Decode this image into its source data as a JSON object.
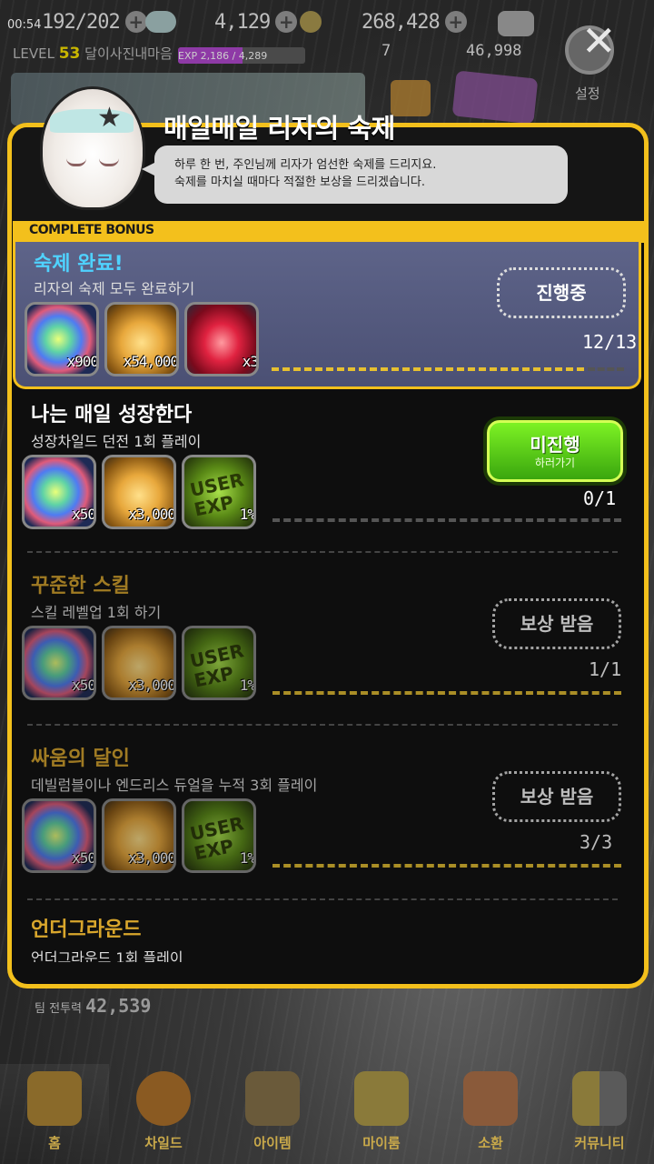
{
  "status": {
    "clock": "00:54",
    "stamina": "192/202",
    "gems": "4,129",
    "gold": "268,428",
    "level_prefix": "LEVEL",
    "level": "53",
    "username": "달이사진내마음",
    "exp": "EXP 2,186 / 4,289",
    "exp_fraction": 0.51,
    "tickets": "7",
    "points": "46,998",
    "settings_label": "설정"
  },
  "dialog": {
    "title": "매일매일 리자의 숙제",
    "message_line1": "하루 한 번, 주인님께 리자가 엄선한 숙제를 드리지요.",
    "message_line2": "숙제를 마치실 때마다 적절한 보상을 드리겠습니다.",
    "bonus_tag": "COMPLETE BONUS"
  },
  "quests": [
    {
      "title": "숙제 완료!",
      "desc": "리자의 숙제 모두 완료하기",
      "rewards": [
        {
          "type": "gem",
          "count": "x900"
        },
        {
          "type": "gold",
          "count": "x54,000"
        },
        {
          "type": "ruby",
          "count": "x3"
        }
      ],
      "button": "진행중",
      "progress": "12/13"
    },
    {
      "title": "나는 매일 성장한다",
      "desc": "성장차일드 던전 1회 플레이",
      "rewards": [
        {
          "type": "gem",
          "count": "x50"
        },
        {
          "type": "gold",
          "count": "x3,000"
        },
        {
          "type": "exp",
          "count": "1%"
        }
      ],
      "button": "미진행",
      "button_sub": "하러가기",
      "progress": "0/1"
    },
    {
      "title": "꾸준한 스킬",
      "desc": "스킬 레벨업 1회 하기",
      "rewards": [
        {
          "type": "gem",
          "count": "x50"
        },
        {
          "type": "gold",
          "count": "x3,000"
        },
        {
          "type": "exp",
          "count": "1%"
        }
      ],
      "button": "보상 받음",
      "progress": "1/1"
    },
    {
      "title": "싸움의 달인",
      "desc": "데빌럼블이나 엔드리스 듀얼을 누적 3회 플레이",
      "rewards": [
        {
          "type": "gem",
          "count": "x50"
        },
        {
          "type": "gold",
          "count": "x3,000"
        },
        {
          "type": "exp",
          "count": "1%"
        }
      ],
      "button": "보상 받음",
      "progress": "3/3"
    },
    {
      "title": "언더그라운드",
      "desc": "언더그라운드 1회 플레이"
    }
  ],
  "exp_icon_text": "USER EXP",
  "team_power_label": "팀 전투력",
  "team_power": "42,539",
  "nav": [
    "홈",
    "차일드",
    "아이템",
    "마이룸",
    "소환",
    "커뮤니티"
  ]
}
